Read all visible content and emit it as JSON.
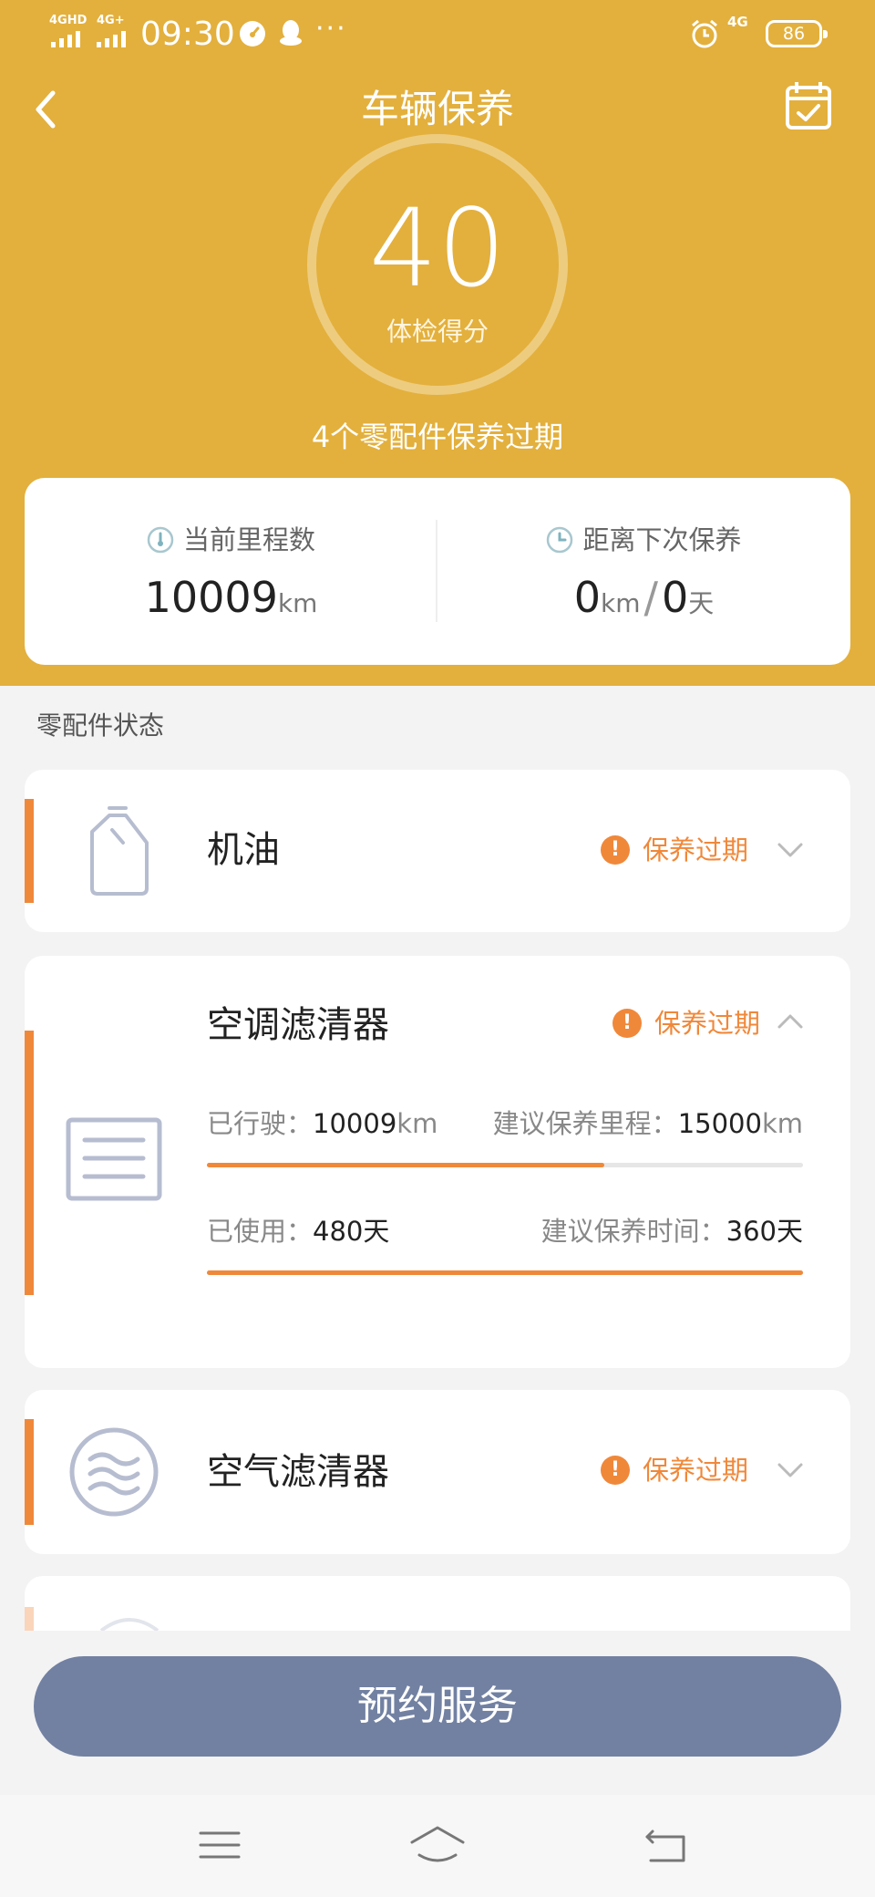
{
  "status_bar": {
    "network1": "4GHD",
    "network2": "4G+",
    "time": "09:30",
    "more": "···",
    "network3": "4G",
    "battery": "86",
    "icons": [
      "speed-icon",
      "qq-icon",
      "alarm-icon"
    ]
  },
  "nav": {
    "title": "车辆保养",
    "back_icon": "chevron-left-icon",
    "calendar_icon": "calendar-check-icon"
  },
  "score": {
    "value": "40",
    "label": "体检得分",
    "summary": "4个零配件保养过期"
  },
  "info": {
    "mileage_label": "当前里程数",
    "mileage_value": "10009",
    "mileage_unit": "km",
    "next_label": "距离下次保养",
    "next_km": "0",
    "next_km_unit": "km",
    "separator": "/",
    "next_days": "0",
    "next_days_unit": "天"
  },
  "section_title": "零配件状态",
  "parts": [
    {
      "name": "机油",
      "status": "保养过期",
      "warn_glyph": "!",
      "icon": "oil-bottle-icon",
      "expanded": false
    },
    {
      "name": "空调滤清器",
      "status": "保养过期",
      "warn_glyph": "!",
      "icon": "ac-filter-icon",
      "expanded": true,
      "driven_label": "已行驶：",
      "driven_value": "10009",
      "driven_unit": "km",
      "suggest_km_label": "建议保养里程：",
      "suggest_km_value": "15000",
      "suggest_km_unit": "km",
      "km_progress": 0.667,
      "used_label": "已使用：",
      "used_value": "480天",
      "suggest_time_label": "建议保养时间：",
      "suggest_time_value": "360天",
      "time_progress": 1.0
    },
    {
      "name": "空气滤清器",
      "status": "保养过期",
      "warn_glyph": "!",
      "icon": "air-filter-icon",
      "expanded": false
    }
  ],
  "book_button": "预约服务",
  "colors": {
    "header": "#e3b03d",
    "accent": "#f0883a",
    "button": "#7281a2"
  }
}
